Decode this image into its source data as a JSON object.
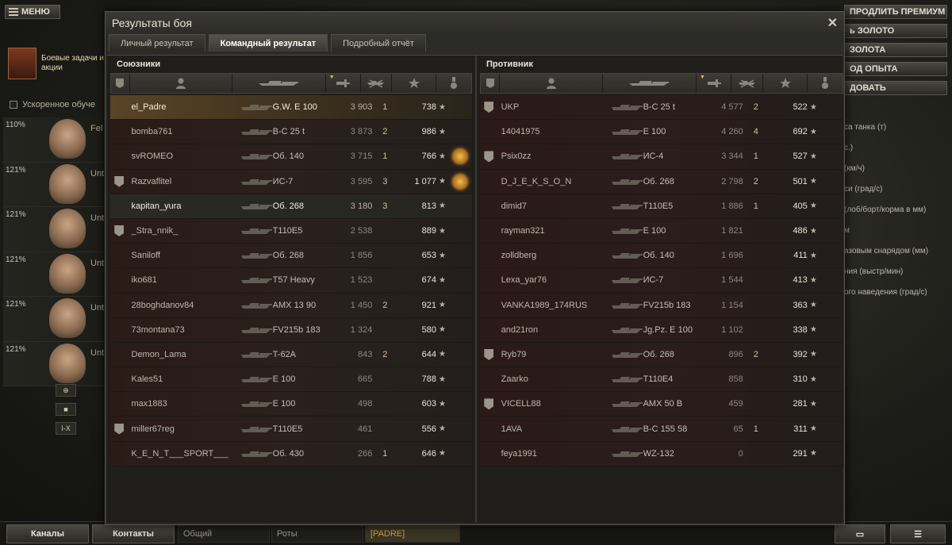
{
  "garage": {
    "menu_label": "МЕНЮ",
    "tasks_label": "Боевые задачи и акции",
    "accel_label": "Ускоренное обуче",
    "crew": [
      {
        "pct": "110%",
        "name": "Fel"
      },
      {
        "pct": "121%",
        "name": "Unt"
      },
      {
        "pct": "121%",
        "name": "Unt"
      },
      {
        "pct": "121%",
        "name": "Unt"
      },
      {
        "pct": "121%",
        "name": "Unt"
      },
      {
        "pct": "121%",
        "name": "Unt"
      }
    ],
    "tools": [
      "■",
      "I-X"
    ],
    "right_buttons": [
      "ПРОДЛИТЬ ПРЕМИУМ",
      "ь ЗОЛОТО",
      "ЗОЛОТА",
      "ОД ОПЫТА",
      "ДОВАТЬ"
    ],
    "props": [
      "са танка (т)",
      "с.)",
      "(км/ч)",
      "си (град/с)",
      "(лоб/борт/корма в мм)",
      "м",
      "азовым снарядом (мм)",
      "ния (выстр/мин)",
      "ого наведения (град/с)"
    ],
    "bottom": {
      "channels": "Каналы",
      "contacts": "Контакты",
      "tab_common": "Общий",
      "tab_companies": "Роты",
      "tab_squad": "[PADRE]"
    }
  },
  "window": {
    "title": "Результаты боя",
    "close": "✕",
    "tabs": [
      "Личный результат",
      "Командный результат",
      "Подробный отчёт"
    ],
    "ally_title": "Союзники",
    "enemy_title": "Противник"
  },
  "allies": [
    {
      "platoon": false,
      "name": "el_Padre",
      "vehicle": "G.W. E 100",
      "damage": "3 903",
      "kills": "1",
      "xp": "738",
      "medal": false,
      "style": "me"
    },
    {
      "platoon": false,
      "name": "bomba761",
      "vehicle": "B-C 25 t",
      "damage": "3 873",
      "kills": "2",
      "xp": "986",
      "medal": false,
      "style": ""
    },
    {
      "platoon": false,
      "name": "svROMEO",
      "vehicle": "Об. 140",
      "damage": "3 715",
      "kills": "1",
      "xp": "766",
      "medal": true,
      "style": ""
    },
    {
      "platoon": true,
      "name": "Razvaflitel",
      "vehicle": "ИС-7",
      "damage": "3 595",
      "kills": "3",
      "xp": "1 077",
      "medal": true,
      "style": ""
    },
    {
      "platoon": false,
      "name": "kapitan_yura",
      "vehicle": "Об. 268",
      "damage": "3 180",
      "kills": "3",
      "xp": "813",
      "medal": false,
      "style": "squad"
    },
    {
      "platoon": true,
      "name": "_Stra_nnik_",
      "vehicle": "T110E5",
      "damage": "2 538",
      "kills": "",
      "xp": "889",
      "medal": false,
      "style": ""
    },
    {
      "platoon": false,
      "name": "Saniloff",
      "vehicle": "Об. 268",
      "damage": "1 856",
      "kills": "",
      "xp": "653",
      "medal": false,
      "style": ""
    },
    {
      "platoon": false,
      "name": "iko681",
      "vehicle": "T57 Heavy",
      "damage": "1 523",
      "kills": "",
      "xp": "674",
      "medal": false,
      "style": ""
    },
    {
      "platoon": false,
      "name": "28boghdanov84",
      "vehicle": "AMX 13 90",
      "damage": "1 450",
      "kills": "2",
      "xp": "921",
      "medal": false,
      "style": ""
    },
    {
      "platoon": false,
      "name": "73montana73",
      "vehicle": "FV215b 183",
      "damage": "1 324",
      "kills": "",
      "xp": "580",
      "medal": false,
      "style": ""
    },
    {
      "platoon": false,
      "name": "Demon_Lama",
      "vehicle": "T-62A",
      "damage": "843",
      "kills": "2",
      "xp": "644",
      "medal": false,
      "style": ""
    },
    {
      "platoon": false,
      "name": "Kales51",
      "vehicle": "E 100",
      "damage": "665",
      "kills": "",
      "xp": "788",
      "medal": false,
      "style": ""
    },
    {
      "platoon": false,
      "name": "max1883",
      "vehicle": "E 100",
      "damage": "498",
      "kills": "",
      "xp": "603",
      "medal": false,
      "style": ""
    },
    {
      "platoon": true,
      "name": "miller67reg",
      "vehicle": "T110E5",
      "damage": "461",
      "kills": "",
      "xp": "556",
      "medal": false,
      "style": ""
    },
    {
      "platoon": false,
      "name": "K_E_N_T___SPORT___",
      "vehicle": "Об. 430",
      "damage": "266",
      "kills": "1",
      "xp": "646",
      "medal": false,
      "style": ""
    }
  ],
  "enemies": [
    {
      "platoon": true,
      "name": "UKP",
      "vehicle": "B-C 25 t",
      "damage": "4 577",
      "kills": "2",
      "xp": "522",
      "medal": false,
      "style": ""
    },
    {
      "platoon": false,
      "name": "14041975",
      "vehicle": "E 100",
      "damage": "4 260",
      "kills": "4",
      "xp": "692",
      "medal": false,
      "style": ""
    },
    {
      "platoon": true,
      "name": "Psix0zz",
      "vehicle": "ИС-4",
      "damage": "3 344",
      "kills": "1",
      "xp": "527",
      "medal": false,
      "style": ""
    },
    {
      "platoon": false,
      "name": "D_J_E_K_S_O_N",
      "vehicle": "Об. 268",
      "damage": "2 798",
      "kills": "2",
      "xp": "501",
      "medal": false,
      "style": ""
    },
    {
      "platoon": false,
      "name": "dimid7",
      "vehicle": "T110E5",
      "damage": "1 886",
      "kills": "1",
      "xp": "405",
      "medal": false,
      "style": ""
    },
    {
      "platoon": false,
      "name": "rayman321",
      "vehicle": "E 100",
      "damage": "1 821",
      "kills": "",
      "xp": "486",
      "medal": false,
      "style": ""
    },
    {
      "platoon": false,
      "name": "zolldberg",
      "vehicle": "Об. 140",
      "damage": "1 696",
      "kills": "",
      "xp": "411",
      "medal": false,
      "style": ""
    },
    {
      "platoon": false,
      "name": "Lexa_yar76",
      "vehicle": "ИС-7",
      "damage": "1 544",
      "kills": "",
      "xp": "413",
      "medal": false,
      "style": ""
    },
    {
      "platoon": false,
      "name": "VANKA1989_174RUS",
      "vehicle": "FV215b 183",
      "damage": "1 154",
      "kills": "",
      "xp": "363",
      "medal": false,
      "style": ""
    },
    {
      "platoon": false,
      "name": "and21ron",
      "vehicle": "Jg.Pz. E 100",
      "damage": "1 102",
      "kills": "",
      "xp": "338",
      "medal": false,
      "style": ""
    },
    {
      "platoon": true,
      "name": "Ryb79",
      "vehicle": "Об. 268",
      "damage": "896",
      "kills": "2",
      "xp": "392",
      "medal": false,
      "style": ""
    },
    {
      "platoon": false,
      "name": "Zaarko",
      "vehicle": "T110E4",
      "damage": "858",
      "kills": "",
      "xp": "310",
      "medal": false,
      "style": ""
    },
    {
      "platoon": true,
      "name": "VICELL88",
      "vehicle": "AMX 50 B",
      "damage": "459",
      "kills": "",
      "xp": "281",
      "medal": false,
      "style": ""
    },
    {
      "platoon": false,
      "name": "1AVA",
      "vehicle": "B-C 155 58",
      "damage": "65",
      "kills": "1",
      "xp": "311",
      "medal": false,
      "style": ""
    },
    {
      "platoon": false,
      "name": "feya1991",
      "vehicle": "WZ-132",
      "damage": "0",
      "kills": "",
      "xp": "291",
      "medal": false,
      "style": ""
    }
  ]
}
